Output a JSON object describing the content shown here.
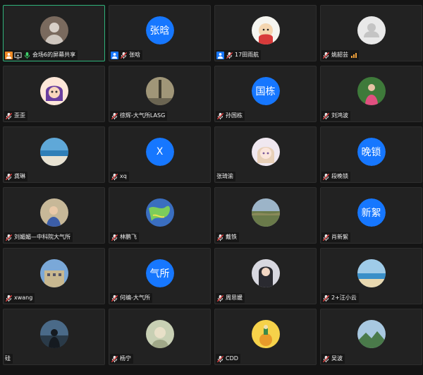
{
  "theme": {
    "accent": "#1677ff",
    "active_border": "#2fb27a",
    "tile_bg": "#222222",
    "signal": "#f0a13a"
  },
  "participants": [
    {
      "name": "会场6的屏幕共享",
      "avatar": {
        "type": "photo",
        "icon": "user-photo-avatar"
      },
      "active": true,
      "icons": [
        "host-badge-icon",
        "screen-share-icon",
        "mic-on-icon"
      ]
    },
    {
      "name": "张晗",
      "avatar": {
        "type": "text",
        "text": "张晗",
        "color": "#1677ff"
      },
      "icons": [
        "user-badge-icon",
        "mic-off-icon"
      ]
    },
    {
      "name": "17田雨航",
      "avatar": {
        "type": "photo",
        "icon": "cartoon-avatar"
      },
      "icons": [
        "user-badge-icon",
        "mic-off-icon"
      ]
    },
    {
      "name": "姚韶芸",
      "avatar": {
        "type": "default",
        "icon": "default-user-avatar"
      },
      "icons": [
        "mic-off-icon"
      ],
      "signal": true
    },
    {
      "name": "歪歪",
      "avatar": {
        "type": "photo",
        "icon": "cartoon-girl-avatar"
      },
      "icons": [
        "mic-off-icon"
      ]
    },
    {
      "name": "徐辉-大气所LASG",
      "avatar": {
        "type": "photo",
        "icon": "tower-photo-avatar"
      },
      "icons": [
        "mic-off-icon"
      ]
    },
    {
      "name": "孙国栋",
      "avatar": {
        "type": "text",
        "text": "国栋",
        "color": "#1677ff"
      },
      "icons": [
        "mic-off-icon"
      ]
    },
    {
      "name": "刘鸿波",
      "avatar": {
        "type": "photo",
        "icon": "person-outdoor-avatar"
      },
      "icons": [
        "mic-off-icon"
      ]
    },
    {
      "name": "龚琳",
      "avatar": {
        "type": "photo",
        "icon": "beach-photo-avatar"
      },
      "icons": [
        "mic-off-icon"
      ]
    },
    {
      "name": "xq",
      "avatar": {
        "type": "text",
        "text": "X",
        "color": "#1677ff"
      },
      "icons": [
        "mic-off-icon"
      ]
    },
    {
      "name": "张琦渝",
      "avatar": {
        "type": "photo",
        "icon": "anime-girl-avatar"
      },
      "icons": []
    },
    {
      "name": "段晚锁",
      "avatar": {
        "type": "text",
        "text": "晚锁",
        "color": "#1677ff"
      },
      "icons": [
        "mic-off-icon"
      ]
    },
    {
      "name": "刘媚媚—中科院大气所",
      "avatar": {
        "type": "photo",
        "icon": "child-photo-avatar"
      },
      "icons": [
        "mic-off-icon"
      ]
    },
    {
      "name": "林鹏飞",
      "avatar": {
        "type": "photo",
        "icon": "map-photo-avatar"
      },
      "icons": [
        "mic-off-icon"
      ]
    },
    {
      "name": "戴铁",
      "avatar": {
        "type": "photo",
        "icon": "landscape-photo-avatar"
      },
      "icons": [
        "mic-off-icon"
      ]
    },
    {
      "name": "肖新絮",
      "avatar": {
        "type": "text",
        "text": "新絮",
        "color": "#1677ff"
      },
      "icons": [
        "mic-off-icon"
      ]
    },
    {
      "name": "xwang",
      "avatar": {
        "type": "photo",
        "icon": "building-photo-avatar"
      },
      "icons": [
        "mic-off-icon"
      ]
    },
    {
      "name": "何编-大气所",
      "avatar": {
        "type": "text",
        "text": "气所",
        "color": "#1677ff"
      },
      "icons": [
        "mic-off-icon"
      ]
    },
    {
      "name": "周思媛",
      "avatar": {
        "type": "photo",
        "icon": "woman-photo-avatar"
      },
      "icons": [
        "mic-off-icon"
      ]
    },
    {
      "name": "2+汪小云",
      "avatar": {
        "type": "photo",
        "icon": "coast-photo-avatar"
      },
      "icons": [
        "mic-off-icon"
      ]
    },
    {
      "name": "硅",
      "avatar": {
        "type": "photo",
        "icon": "silhouette-photo-avatar"
      },
      "icons": []
    },
    {
      "name": "杨宁",
      "avatar": {
        "type": "photo",
        "icon": "sketch-photo-avatar"
      },
      "icons": [
        "mic-off-icon"
      ]
    },
    {
      "name": "CDD",
      "avatar": {
        "type": "photo",
        "icon": "little-prince-avatar"
      },
      "icons": [
        "mic-off-icon"
      ]
    },
    {
      "name": "吴波",
      "avatar": {
        "type": "photo",
        "icon": "mountain-photo-avatar"
      },
      "icons": [
        "mic-off-icon"
      ]
    }
  ]
}
